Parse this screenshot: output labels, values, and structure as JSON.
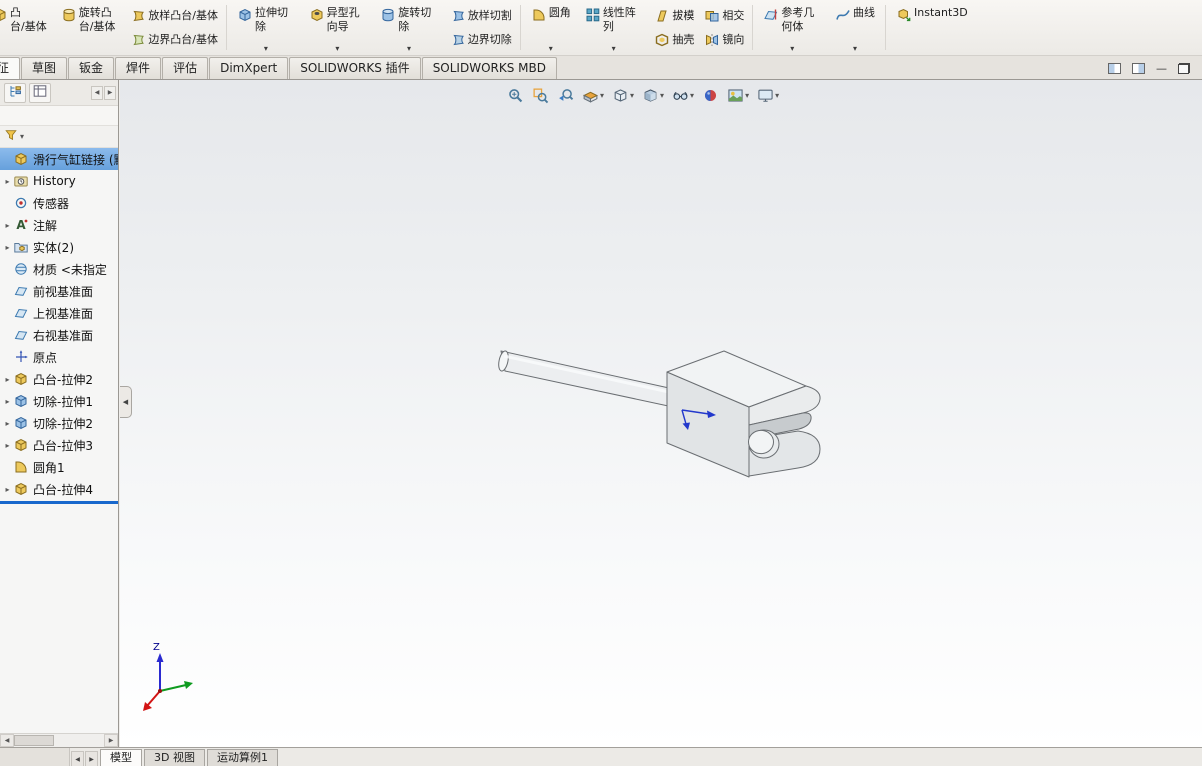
{
  "colors": {
    "selection_blue": "#7fb2e5",
    "rollback_blue": "#1968cc",
    "viewport_gradient_top": "#e6e8eb",
    "viewport_gradient_bottom": "#ffffff"
  },
  "ribbon": {
    "items": [
      {
        "type": "large",
        "label": "凸台/基体",
        "lines": [
          "凸",
          "台/基体"
        ],
        "icon": "extruded-boss-icon",
        "clipped": true
      },
      {
        "type": "large",
        "label": "旋转凸台/基体",
        "icon": "revolved-boss-icon"
      },
      {
        "type": "small",
        "label": "放样凸台/基体",
        "icon": "lofted-boss-icon"
      },
      {
        "type": "small",
        "label": "边界凸台/基体",
        "icon": "boundary-boss-icon"
      },
      {
        "sep": true
      },
      {
        "type": "large",
        "label": "拉伸切除",
        "icon": "extruded-cut-icon",
        "dd": true
      },
      {
        "type": "large",
        "label": "异型孔向导",
        "icon": "hole-wizard-icon",
        "dd": true
      },
      {
        "type": "large",
        "label": "旋转切除",
        "icon": "revolved-cut-icon",
        "dd": true
      },
      {
        "type": "small",
        "label": "放样切割",
        "icon": "lofted-cut-icon"
      },
      {
        "type": "small",
        "label": "边界切除",
        "icon": "boundary-cut-icon"
      },
      {
        "sep": true
      },
      {
        "type": "large",
        "label": "圆角",
        "icon": "fillet-icon",
        "dd": true
      },
      {
        "type": "large",
        "label": "线性阵列",
        "icon": "linear-pattern-icon",
        "dd": true
      },
      {
        "type": "small",
        "label": "拔模",
        "icon": "draft-icon"
      },
      {
        "type": "small",
        "label": "抽壳",
        "icon": "shell-icon"
      },
      {
        "type": "small",
        "label": "相交",
        "icon": "intersect-icon"
      },
      {
        "type": "small",
        "label": "镜向",
        "icon": "mirror-icon"
      },
      {
        "sep": true
      },
      {
        "type": "large",
        "label": "参考几何体",
        "icon": "reference-geometry-icon",
        "dd": true
      },
      {
        "type": "large",
        "label": "曲线",
        "icon": "curves-icon",
        "dd": true
      },
      {
        "sep": true
      },
      {
        "type": "large",
        "label": "Instant3D",
        "icon": "instant3d-icon",
        "latin": true
      }
    ]
  },
  "command_tabs": {
    "minimize_glyph": "—",
    "items": [
      {
        "label": "特征",
        "active": true,
        "clipped": true
      },
      {
        "label": "草图"
      },
      {
        "label": "钣金"
      },
      {
        "label": "焊件"
      },
      {
        "label": "评估"
      },
      {
        "label": "DimXpert"
      },
      {
        "label": "SOLIDWORKS 插件"
      },
      {
        "label": "SOLIDWORKS MBD"
      }
    ]
  },
  "panel": {
    "tab_scroll_left": "◀",
    "tab_scroll_right": "▶",
    "hscroll_left": "◀",
    "hscroll_right": "▶"
  },
  "feature_tree": {
    "expand_glyph": "▸",
    "items": [
      {
        "label": "滑行气缸链接 (默",
        "icon": "part-icon",
        "selected": true
      },
      {
        "label": "History",
        "icon": "history-icon",
        "arrow": true
      },
      {
        "label": "传感器",
        "icon": "sensors-icon"
      },
      {
        "label": "注解",
        "icon": "annotations-icon",
        "arrow": true
      },
      {
        "label": "实体(2)",
        "icon": "bodies-folder-icon",
        "arrow": true
      },
      {
        "label": "材质 <未指定",
        "icon": "material-icon"
      },
      {
        "label": "前视基准面",
        "icon": "plane-icon"
      },
      {
        "label": "上视基准面",
        "icon": "plane-icon"
      },
      {
        "label": "右视基准面",
        "icon": "plane-icon"
      },
      {
        "label": "原点",
        "icon": "origin-icon"
      },
      {
        "label": "凸台-拉伸2",
        "icon": "boss-extrude-icon",
        "arrow": true
      },
      {
        "label": "切除-拉伸1",
        "icon": "cut-extrude-icon",
        "arrow": true
      },
      {
        "label": "切除-拉伸2",
        "icon": "cut-extrude-icon",
        "arrow": true
      },
      {
        "label": "凸台-拉伸3",
        "icon": "boss-extrude-icon",
        "arrow": true
      },
      {
        "label": "圆角1",
        "icon": "fillet-icon"
      },
      {
        "label": "凸台-拉伸4",
        "icon": "boss-extrude-icon",
        "arrow": true
      }
    ]
  },
  "viewport": {
    "collapse_arrow": "◀",
    "triad_z_label": "Z",
    "hud": [
      {
        "name": "zoom-to-fit"
      },
      {
        "name": "zoom-to-area"
      },
      {
        "name": "previous-view"
      },
      {
        "name": "section-view",
        "dd": true
      },
      {
        "name": "view-orientation",
        "dd": true
      },
      {
        "name": "display-style",
        "dd": true
      },
      {
        "name": "hide-show-items",
        "dd": true
      },
      {
        "name": "edit-appearance"
      },
      {
        "name": "apply-scene",
        "dd": true
      },
      {
        "name": "view-settings",
        "dd": true
      }
    ]
  },
  "bottom_bar": {
    "nav_left": "◀",
    "nav_right": "▶",
    "tabs": [
      {
        "label": "模型",
        "active": true
      },
      {
        "label": "3D 视图"
      },
      {
        "label": "运动算例1"
      }
    ]
  }
}
